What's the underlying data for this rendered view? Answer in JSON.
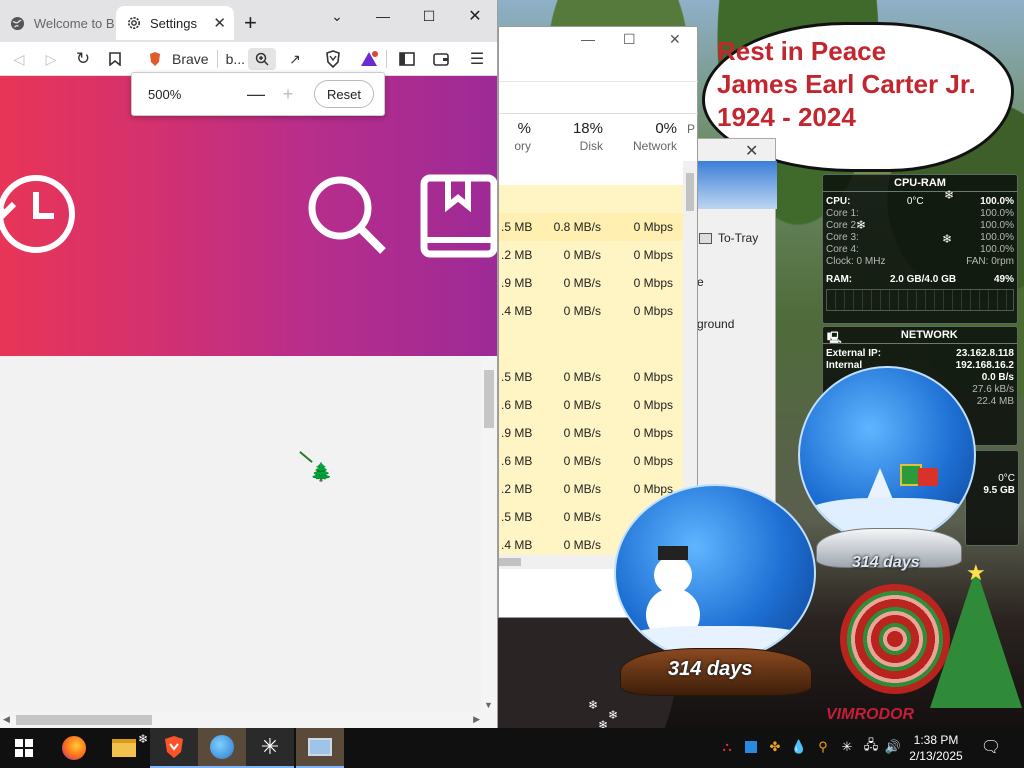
{
  "browser": {
    "tabs": [
      {
        "label": "Welcome to B"
      },
      {
        "label": "Settings"
      }
    ],
    "toolbar": {
      "brave_label": "Brave",
      "site_label": "b..."
    },
    "zoom_popup": {
      "value": "500%",
      "minus": "—",
      "plus": "+",
      "reset_label": "Reset"
    }
  },
  "task_manager": {
    "columns": [
      {
        "pct": "%",
        "label": "ory"
      },
      {
        "pct": "18%",
        "label": "Disk"
      },
      {
        "pct": "0%",
        "label": "Network"
      },
      {
        "pct": "",
        "label": "P"
      }
    ],
    "rows_group1": [
      {
        "mem": ".5 MB",
        "disk": "0.8 MB/s",
        "net": "0 Mbps"
      },
      {
        "mem": ".2 MB",
        "disk": "0 MB/s",
        "net": "0 Mbps"
      },
      {
        "mem": ".9 MB",
        "disk": "0 MB/s",
        "net": "0 Mbps"
      },
      {
        "mem": ".4 MB",
        "disk": "0 MB/s",
        "net": "0 Mbps"
      }
    ],
    "rows_group2": [
      {
        "mem": ".5 MB",
        "disk": "0 MB/s",
        "net": "0 Mbps"
      },
      {
        "mem": ".6 MB",
        "disk": "0 MB/s",
        "net": "0 Mbps"
      },
      {
        "mem": ".9 MB",
        "disk": "0 MB/s",
        "net": "0 Mbps"
      },
      {
        "mem": ".6 MB",
        "disk": "0 MB/s",
        "net": "0 Mbps"
      },
      {
        "mem": ".2 MB",
        "disk": "0 MB/s",
        "net": "0 Mbps"
      },
      {
        "mem": ".5 MB",
        "disk": "0 MB/s",
        "net": "0 Mb"
      },
      {
        "mem": ".4 MB",
        "disk": "0 MB/s",
        "net": ""
      }
    ]
  },
  "dialog": {
    "to_tray": "To-Tray",
    "line1": "e",
    "line2": "kground"
  },
  "sign": {
    "line1": "Rest in Peace",
    "line2": "James Earl Carter Jr.",
    "line3": "1924 - 2024"
  },
  "cpu_gadget": {
    "title": "CPU-RAM",
    "cpu_label": "CPU:",
    "cpu_temp": "0°C",
    "cpu_pct": "100.0%",
    "cores": [
      {
        "label": "Core 1:",
        "value": "100.0%"
      },
      {
        "label": "Core 2:",
        "value": "100.0%"
      },
      {
        "label": "Core 3:",
        "value": "100.0%"
      },
      {
        "label": "Core 4:",
        "value": "100.0%"
      }
    ],
    "clock": "Clock: 0 MHz",
    "fan": "FAN: 0rpm",
    "ram_label": "RAM:",
    "ram_value": "2.0 GB/4.0 GB",
    "ram_pct": "49%"
  },
  "net_gadget": {
    "title": "NETWORK",
    "external_label": "External IP:",
    "external_value": "23.162.8.118",
    "internal_label": "Internal",
    "internal_value": "192.168.16.2",
    "rate1": "0.0 B/s",
    "rate2": "27.6 kB/s",
    "rate3": "22.4 MB"
  },
  "extra_gadget": {
    "temp": "0°C",
    "size": "9.5 GB"
  },
  "globes": {
    "left_days": "314 days",
    "right_days": "314 days"
  },
  "watermark": "VIMRODOR",
  "taskbar": {
    "time": "1:38 PM",
    "date": "2/13/2025"
  },
  "colors": {
    "hero_start": "#e83557",
    "hero_end": "#9d2a97",
    "sign_text": "#c2262e",
    "taskbar": "#101010"
  }
}
